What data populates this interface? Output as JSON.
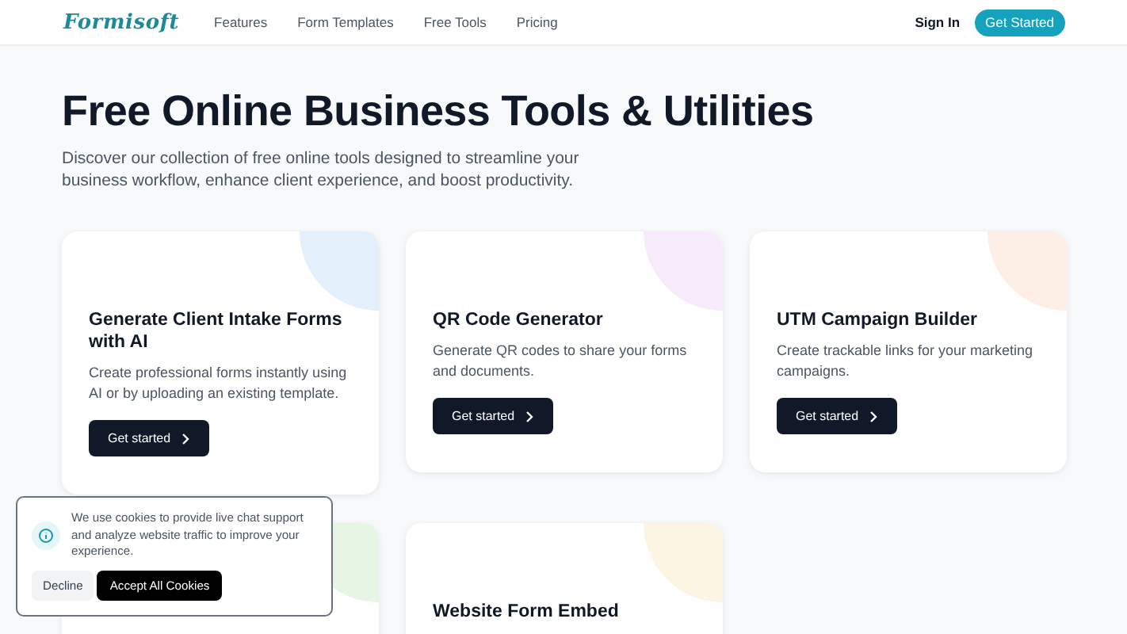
{
  "nav": {
    "logo": "Formisoft",
    "links": [
      "Features",
      "Form Templates",
      "Free Tools",
      "Pricing"
    ],
    "sign_in": "Sign In",
    "cta": "Get Started"
  },
  "hero": {
    "title": "Free Online Business Tools & Utilities",
    "subtitle": "Discover our collection of free online tools designed to streamline your business workflow, enhance client experience, and boost productivity."
  },
  "cards": [
    {
      "title": "Generate Client Intake Forms with AI",
      "description": "Create professional forms instantly using AI or by uploading an existing template.",
      "button": "Get started",
      "color": "#e3f0fc"
    },
    {
      "title": "QR Code Generator",
      "description": "Generate QR codes to share your forms and documents.",
      "button": "Get started",
      "color": "#f6eafb"
    },
    {
      "title": "UTM Campaign Builder",
      "description": "Create trackable links for your marketing campaigns.",
      "button": "Get started",
      "color": "#fdeee6"
    },
    {
      "color": "#e7f6e4"
    },
    {
      "title": "Website Form Embed",
      "color": "#fdf5e4"
    }
  ],
  "cookie": {
    "text": "We use cookies to provide live chat support and analyze website traffic to improve your experience.",
    "decline": "Decline",
    "accept": "Accept All Cookies"
  }
}
